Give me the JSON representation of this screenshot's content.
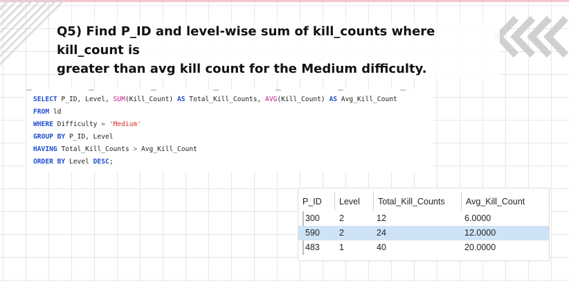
{
  "question": {
    "line1": "Q5) Find P_ID and level-wise sum of kill_counts where kill_count is",
    "line2": "greater than avg kill count for the Medium difficulty."
  },
  "sql": {
    "l1": {
      "select": "SELECT",
      "cols": " P_ID, Level, ",
      "sum": "SUM",
      "sum_arg": "(Kill_Count) ",
      "as1": "AS",
      "alias1": " Total_Kill_Counts, ",
      "avg": "AVG",
      "avg_arg": "(Kill_Count) ",
      "as2": "AS",
      "alias2": " Avg_Kill_Count"
    },
    "l2": {
      "from": "FROM",
      "table": " ld"
    },
    "l3": {
      "where": "WHERE",
      "cond": " Difficulty ",
      "eq": "=",
      "val": " 'Medium'"
    },
    "l4": {
      "group": "GROUP BY",
      "cols": " P_ID, Level"
    },
    "l5": {
      "having": "HAVING",
      "cond": " Total_Kill_Counts ",
      "gt": ">",
      "cond2": " Avg_Kill_Count"
    },
    "l6": {
      "order": "ORDER BY",
      "col": " Level ",
      "desc": "DESC",
      "semi": ";"
    }
  },
  "results": {
    "columns": [
      "P_ID",
      "Level",
      "Total_Kill_Counts",
      "Avg_Kill_Count"
    ],
    "rows": [
      [
        "300",
        "2",
        "12",
        "6.0000"
      ],
      [
        "590",
        "2",
        "24",
        "12.0000"
      ],
      [
        "483",
        "1",
        "40",
        "20.0000"
      ]
    ]
  },
  "colors": {
    "keyword": "#1f4fd1",
    "function": "#c2188c",
    "string": "#d62a2a",
    "selected_row": "#cfe3f7"
  }
}
